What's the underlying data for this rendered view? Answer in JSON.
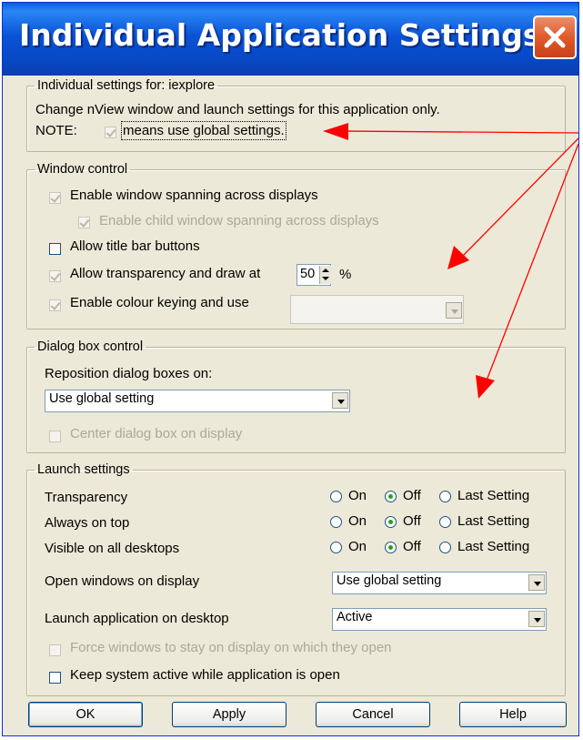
{
  "dialog": {
    "title": "Individual Application Settings"
  },
  "individual": {
    "legend": "Individual settings for: iexplore",
    "line1": "Change nView window and launch settings for this application only.",
    "note_label": "NOTE:",
    "note_text": "means use global settings."
  },
  "window_control": {
    "legend": "Window control",
    "spanning": "Enable window spanning across displays",
    "child_spanning": "Enable child window spanning across displays",
    "title_buttons": "Allow title bar buttons",
    "transparency_label": "Allow transparency and draw at",
    "transparency_value": "50",
    "transparency_unit": "%",
    "colour_keying": "Enable colour keying and use",
    "colour_value": ""
  },
  "dialog_box_control": {
    "legend": "Dialog box control",
    "reposition_label": "Reposition dialog boxes on:",
    "reposition_value": "Use global setting",
    "center_label": "Center dialog box on display"
  },
  "launch": {
    "legend": "Launch settings",
    "option_on": "On",
    "option_off": "Off",
    "option_last": "Last Setting",
    "rows": [
      {
        "label": "Transparency",
        "selected": "Off"
      },
      {
        "label": "Always on top",
        "selected": "Off"
      },
      {
        "label": "Visible on all desktops",
        "selected": "Off"
      }
    ],
    "open_label": "Open windows on display",
    "open_value": "Use global setting",
    "desktop_label": "Launch application on desktop",
    "desktop_value": "Active",
    "force_label": "Force windows to stay on display on which they open",
    "keep_label": "Keep system active while application is open"
  },
  "buttons": {
    "ok": "OK",
    "apply": "Apply",
    "cancel": "Cancel",
    "help": "Help"
  },
  "colors": {
    "title_bar": "#0a53d6",
    "close_button": "#e05a2a",
    "arrow": "#ff0000",
    "dialog_face": "#ece9d8"
  }
}
